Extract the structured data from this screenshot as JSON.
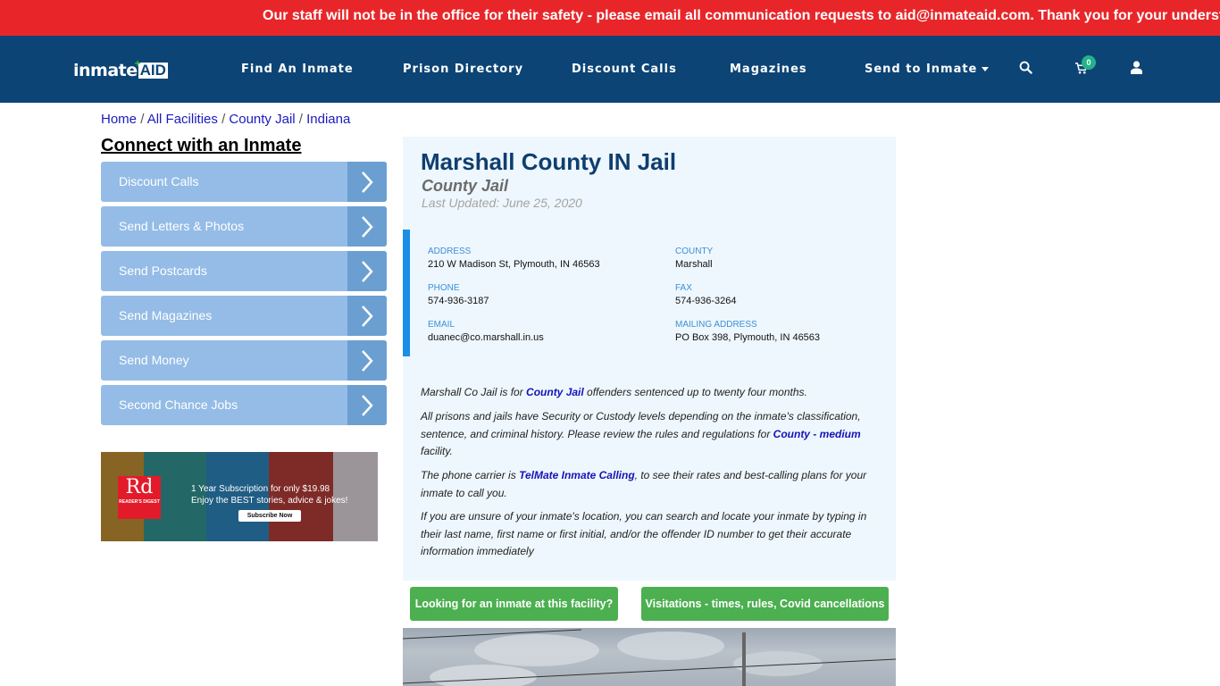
{
  "alert": {
    "message": "Our staff will not be in the office for their safety - please email all communication requests to aid@inmateaid.com. Thank you for your understanding."
  },
  "header": {
    "logo": {
      "part1": "inmate",
      "part2": "AID"
    },
    "nav": [
      {
        "label": "Find An Inmate"
      },
      {
        "label": "Prison Directory"
      },
      {
        "label": "Discount Calls"
      },
      {
        "label": "Magazines"
      },
      {
        "label": "Send to Inmate",
        "has_dropdown": true
      }
    ],
    "icons": {
      "search": "search-icon",
      "cart": "cart-icon",
      "user": "user-icon"
    },
    "cart_count": "0",
    "colors": {
      "navbar": "#0c4475",
      "alert": "#e8262a",
      "badge": "#23b38a"
    }
  },
  "breadcrumb": {
    "items": [
      "Home",
      "All Facilities",
      "County Jail",
      "Indiana"
    ],
    "separator": "/"
  },
  "sidebar": {
    "title": "Connect with an Inmate",
    "items": [
      {
        "label": "Discount Calls"
      },
      {
        "label": "Send Letters & Photos"
      },
      {
        "label": "Send Postcards"
      },
      {
        "label": "Send Magazines"
      },
      {
        "label": "Send Money"
      },
      {
        "label": "Second Chance Jobs"
      }
    ],
    "ad": {
      "brand_short": "Rd",
      "brand_name": "READER'S DIGEST",
      "line1": "1 Year Subscription for only $19.98",
      "line2": "Enjoy the BEST stories, advice & jokes!",
      "cta": "Subscribe Now"
    }
  },
  "facility": {
    "name": "Marshall County IN Jail",
    "type": "County Jail",
    "last_updated": "Last Updated: June 25, 2020",
    "details": {
      "address": {
        "label": "Address",
        "value": "210 W Madison St, Plymouth, IN 46563"
      },
      "county": {
        "label": "County",
        "value": "Marshall"
      },
      "phone": {
        "label": "Phone",
        "value": "574-936-3187"
      },
      "fax": {
        "label": "Fax",
        "value": "574-936-3264"
      },
      "email": {
        "label": "Email",
        "value": "duanec@co.marshall.in.us"
      },
      "mailing": {
        "label": "Mailing Address",
        "value": "PO Box 398, Plymouth, IN 46563"
      }
    },
    "description": {
      "p1": {
        "before": "Marshall Co Jail is for ",
        "link": "County Jail",
        "after": " offenders sentenced up to twenty four months."
      },
      "p2": {
        "before": "All prisons and jails have Security or Custody levels depending on the inmate's classification, sentence, and criminal history. Please review the rules and regulations for ",
        "link": "County - medium",
        "after": " facility."
      },
      "p3": {
        "before": "The phone carrier is ",
        "link": "TelMate Inmate Calling",
        "after": ", to see their rates and best-calling plans for your inmate to call you."
      },
      "p4": {
        "text": "If you are unsure of your inmate's location, you can search and locate your inmate by typing in their last name, first name or first initial, and/or the offender ID number to get their accurate information immediately"
      }
    },
    "buttons": {
      "find_inmate": "Looking for an inmate at this facility?",
      "visitations": "Visitations - times, rules, Covid cancellations"
    }
  }
}
